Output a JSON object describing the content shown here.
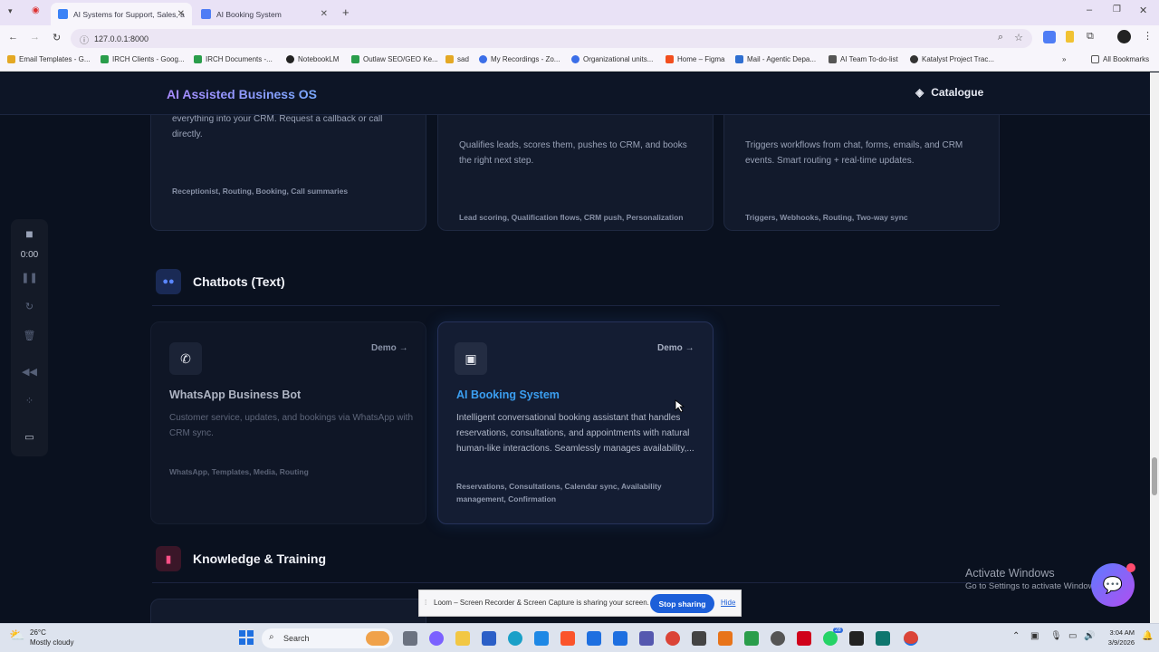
{
  "browser": {
    "tabs": [
      {
        "title": "AI Systems for Support, Sales, a",
        "active": true
      },
      {
        "title": "AI Booking System",
        "active": false
      }
    ],
    "url": "127.0.0.1:8000",
    "bookmarks": [
      "Email Templates - G...",
      "IRCH Clients - Goog...",
      "IRCH Documents -...",
      "NotebookLM",
      "Outlaw SEO/GEO Ke...",
      "sad",
      "My Recordings - Zo...",
      "Organizational units...",
      "Home – Figma",
      "Mail - Agentic Depa...",
      "AI Team To-do-list",
      "Katalyst Project Trac..."
    ],
    "all_bookmarks": "All Bookmarks"
  },
  "header": {
    "brand": "AI Assisted Business OS",
    "catalogue": "Catalogue"
  },
  "top_cards": [
    {
      "desc": "everything into your CRM. Request a callback or call directly.",
      "tags": "Receptionist, Routing, Booking, Call summaries"
    },
    {
      "desc": "Qualifies leads, scores them, pushes to CRM, and books the right next step.",
      "tags": "Lead scoring, Qualification flows, CRM push, Personalization"
    },
    {
      "desc": "Triggers workflows from chat, forms, emails, and CRM events. Smart routing + real-time updates.",
      "tags": "Triggers, Webhooks, Routing, Two-way sync"
    }
  ],
  "sections": {
    "chatbots": "Chatbots (Text)",
    "knowledge": "Knowledge & Training"
  },
  "chat_cards": [
    {
      "title": "WhatsApp Business Bot",
      "demo": "Demo",
      "desc": "Customer service, updates, and bookings via WhatsApp with CRM sync.",
      "tags": "WhatsApp, Templates, Media, Routing"
    },
    {
      "title": "AI Booking System",
      "demo": "Demo",
      "desc": "Intelligent conversational booking assistant that handles reservations, consultations, and appointments with natural human-like interactions. Seamlessly manages availability,...",
      "tags": "Reservations, Consultations, Calendar sync, Availability management, Confirmation"
    }
  ],
  "loom": {
    "timer": "0:00",
    "share_text": "Loom – Screen Recorder & Screen Capture is sharing your screen.",
    "stop": "Stop sharing",
    "hide": "Hide"
  },
  "watermark": {
    "line1": "Activate Windows",
    "line2": "Go to Settings to activate Windows."
  },
  "taskbar": {
    "weather_temp": "26°C",
    "weather_desc": "Mostly cloudy",
    "search": "Search",
    "time": "3:04 AM",
    "date": "3/9/2026",
    "badge": "28"
  },
  "colors": {
    "accent_blue": "#3b9ef0",
    "brand_from": "#a88bff",
    "brand_to": "#7aa9ff",
    "page_bg": "#0a111f"
  }
}
